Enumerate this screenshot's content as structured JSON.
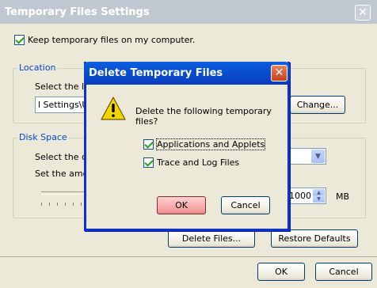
{
  "main_window": {
    "title": "Temporary Files Settings",
    "keep_files_label": "Keep temporary files on my computer.",
    "location": {
      "group_label": "Location",
      "select_label": "Select the lo",
      "path_value": "l Settings\\Us",
      "change_button": "Change..."
    },
    "disk_space": {
      "group_label": "Disk Space",
      "select_label": "Select the co",
      "amount_label": "Set the amou",
      "amount_value": "1000",
      "unit": "MB"
    },
    "delete_files_button": "Delete Files...",
    "restore_defaults_button": "Restore Defaults",
    "ok_button": "OK",
    "cancel_button": "Cancel"
  },
  "dialog": {
    "title": "Delete Temporary Files",
    "prompt": "Delete the following temporary files?",
    "options": [
      {
        "label": "Applications and Applets",
        "checked": true
      },
      {
        "label": "Trace and Log Files",
        "checked": true
      }
    ],
    "ok_button": "OK",
    "cancel_button": "Cancel"
  },
  "colors": {
    "dialog_title": "#0a4fd5",
    "group_label": "#0046d5",
    "ok_highlight": "#f6a0a0"
  }
}
